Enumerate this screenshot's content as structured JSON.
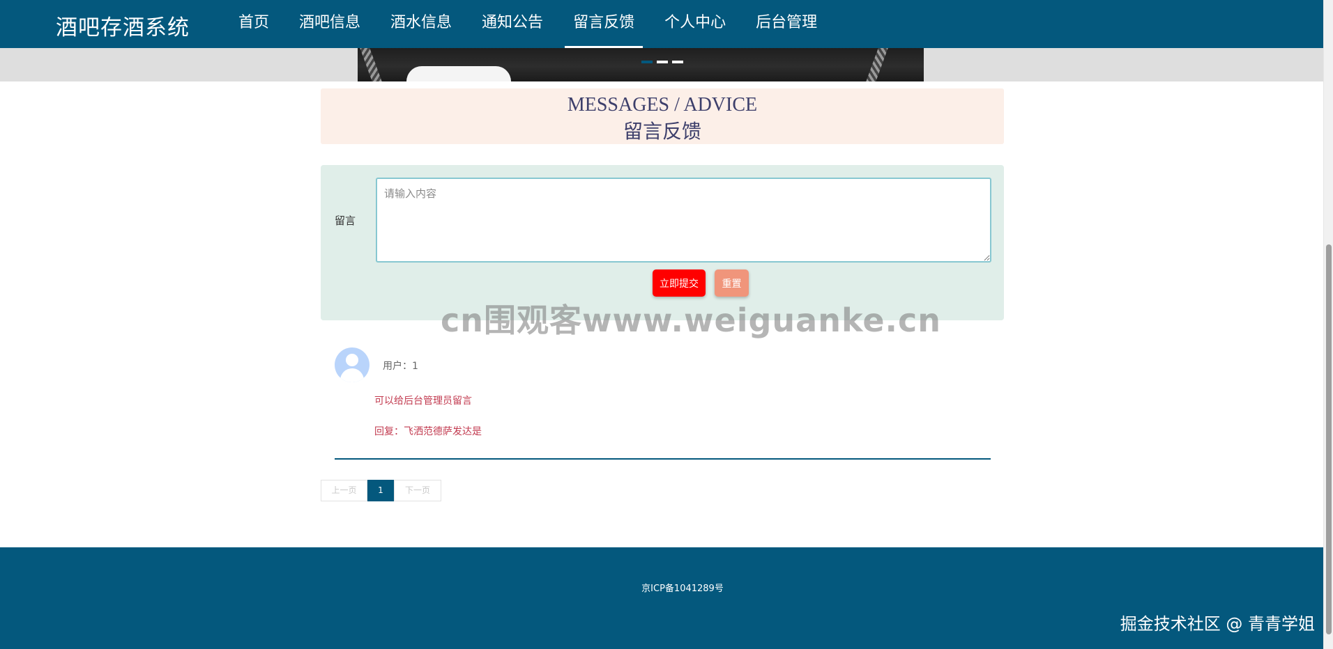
{
  "header": {
    "brand": "酒吧存酒系统",
    "nav": [
      {
        "label": "首页",
        "active": false
      },
      {
        "label": "酒吧信息",
        "active": false
      },
      {
        "label": "酒水信息",
        "active": false
      },
      {
        "label": "通知公告",
        "active": false
      },
      {
        "label": "留言反馈",
        "active": true
      },
      {
        "label": "个人中心",
        "active": false
      },
      {
        "label": "后台管理",
        "active": false
      }
    ]
  },
  "banner": {
    "indicator_count": 3,
    "active_index": 0
  },
  "section_title": {
    "en": "MESSAGES / ADVICE",
    "cn": "留言反馈"
  },
  "form": {
    "label": "留言",
    "placeholder": "请输入内容",
    "value": "",
    "submit_label": "立即提交",
    "reset_label": "重置"
  },
  "comments": [
    {
      "user": "用户：1",
      "content": "可以给后台管理员留言",
      "reply": "回复：飞洒范德萨发达是"
    }
  ],
  "pagination": {
    "prev_label": "上一页",
    "current": "1",
    "next_label": "下一页"
  },
  "footer": {
    "icp": "京ICP备1041289号"
  },
  "watermarks": {
    "center": "cn围观客www.weiguanke.cn",
    "corner": "掘金技术社区 @ 青青学姐"
  },
  "colors": {
    "primary": "#04587d",
    "title_bg": "#fcefe8",
    "form_bg": "#e0eee9",
    "submit": "#ff0000",
    "reset": "#f0957b",
    "comment_text": "#c23a4f"
  }
}
